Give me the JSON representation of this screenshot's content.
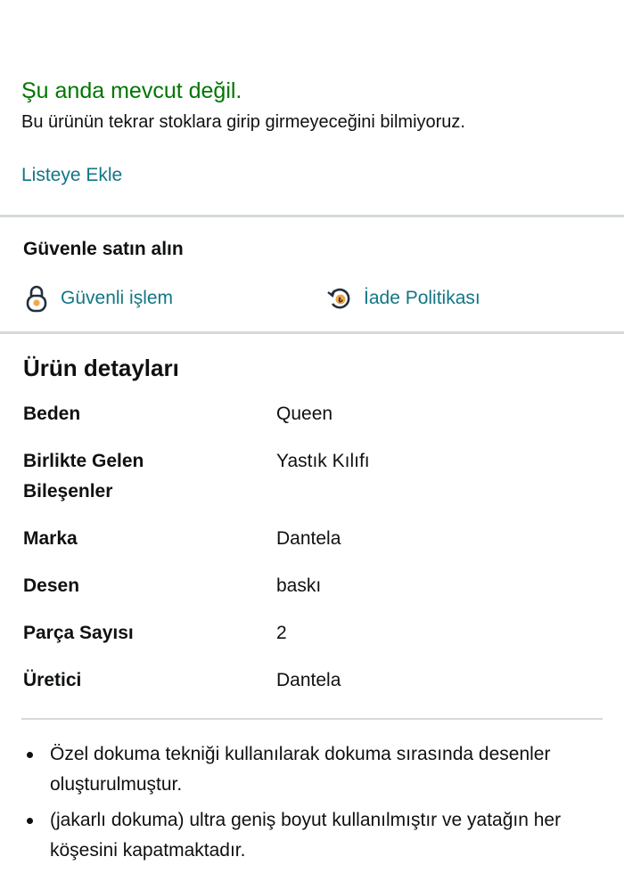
{
  "availability": {
    "status": "Şu anda mevcut değil.",
    "note": "Bu ürünün tekrar stoklara girip girmeyeceğini bilmiyoruz."
  },
  "add_to_list": "Listeye Ekle",
  "secure": {
    "title": "Güvenle satın alın",
    "links": [
      {
        "label": "Güvenli işlem",
        "icon": "lock-icon"
      },
      {
        "label": "İade Politikası",
        "icon": "return-policy-icon"
      }
    ]
  },
  "details": {
    "title": "Ürün detayları",
    "rows": [
      {
        "key": "Beden",
        "value": "Queen"
      },
      {
        "key": "Birlikte Gelen Bileşenler",
        "value": "Yastık Kılıfı"
      },
      {
        "key": "Marka",
        "value": "Dantela"
      },
      {
        "key": "Desen",
        "value": "baskı"
      },
      {
        "key": "Parça Sayısı",
        "value": "2"
      },
      {
        "key": "Üretici",
        "value": "Dantela"
      }
    ]
  },
  "bullets": [
    "Özel dokuma tekniği kullanılarak dokuma sırasında desenler oluşturulmuştur.",
    "(jakarlı dokuma) ultra geniş boyut kullanılmıştır ve yatağın her köşesini kapatmaktadır."
  ],
  "colors": {
    "availability_green": "#007600",
    "link_teal": "#127685",
    "divider_gray": "#d5d9d9",
    "icon_orange": "#f3a847"
  }
}
